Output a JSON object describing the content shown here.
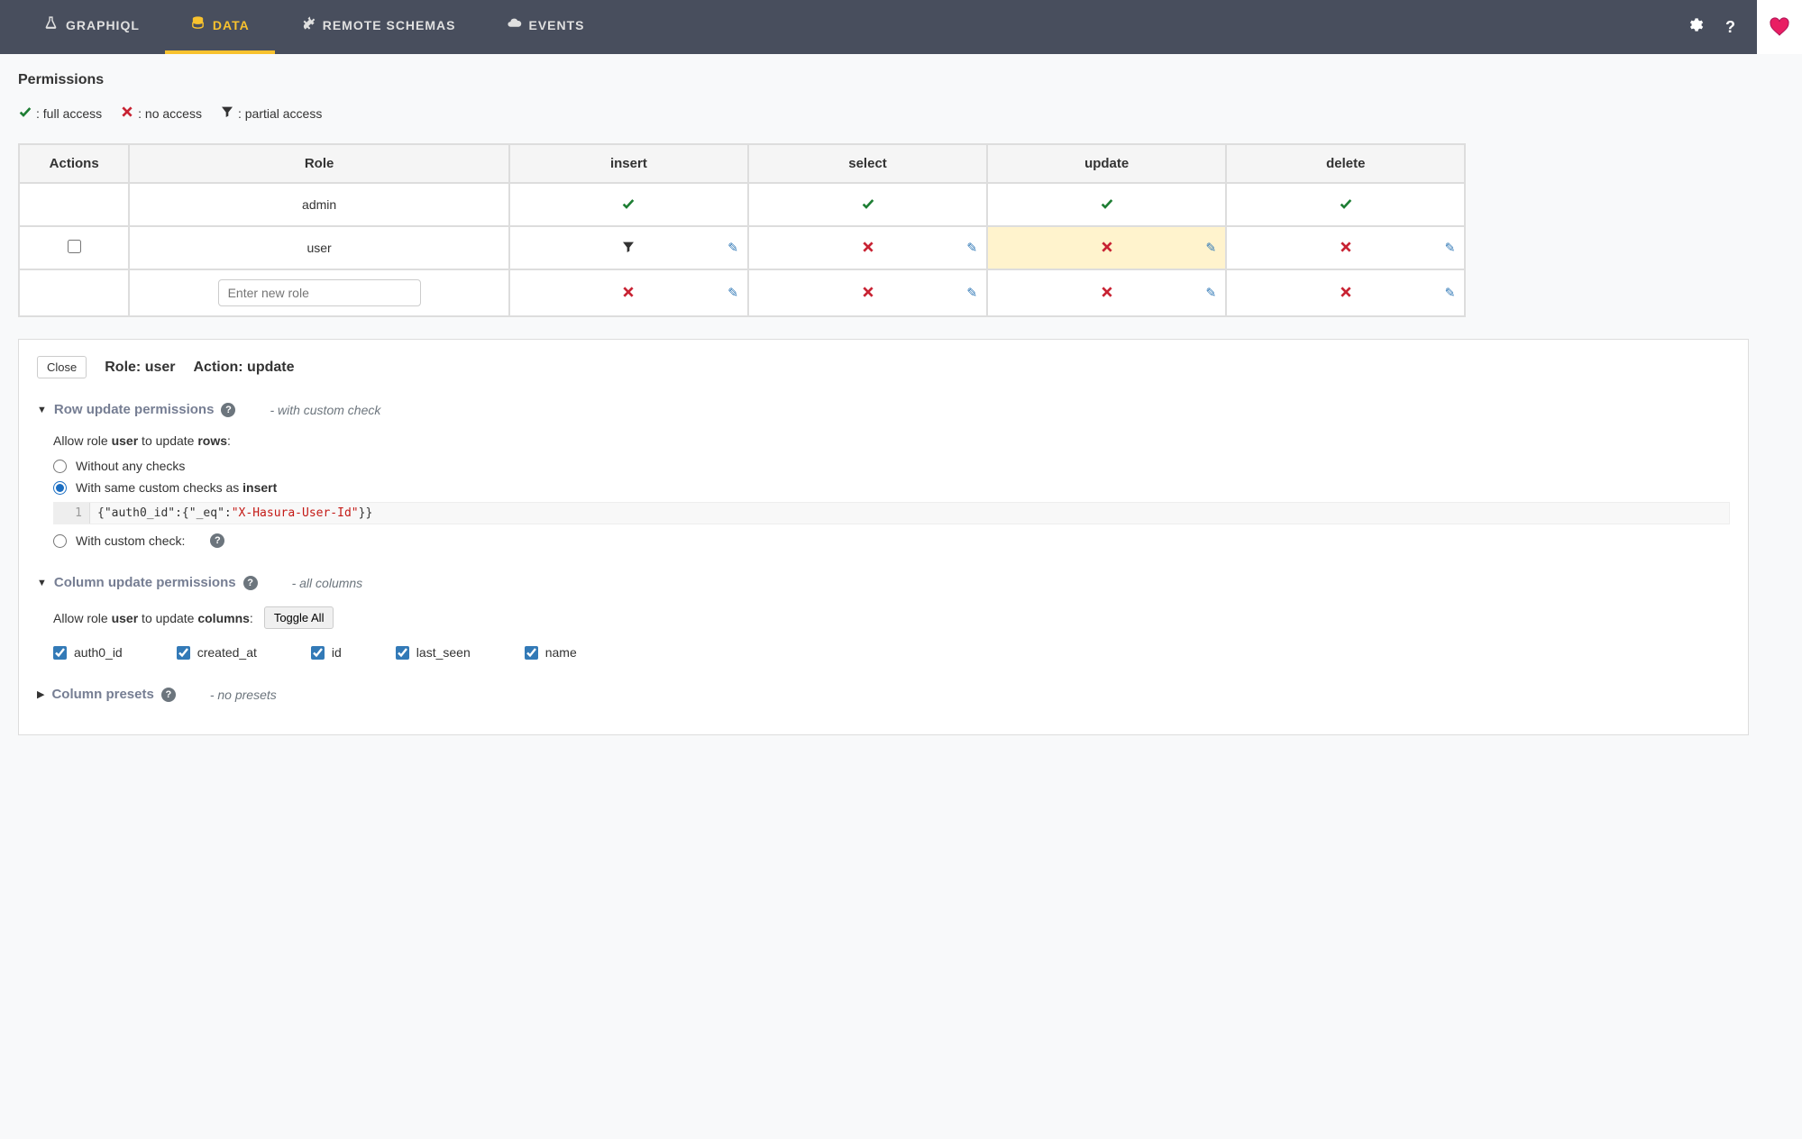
{
  "nav": {
    "items": [
      {
        "label": "GRAPHIQL",
        "icon": "flask"
      },
      {
        "label": "DATA",
        "icon": "database",
        "active": true
      },
      {
        "label": "REMOTE SCHEMAS",
        "icon": "plug"
      },
      {
        "label": "EVENTS",
        "icon": "cloud"
      }
    ],
    "right_icons": [
      "gear-icon",
      "help-icon",
      "heart-icon"
    ]
  },
  "section_title": "Permissions",
  "legend": {
    "full": ": full access",
    "none": ": no access",
    "partial": ": partial access"
  },
  "table": {
    "headers": {
      "actions": "Actions",
      "role": "Role",
      "insert": "insert",
      "select": "select",
      "update": "update",
      "delete": "delete"
    },
    "rows": [
      {
        "role": "admin",
        "cells": {
          "insert": "full",
          "select": "full",
          "update": "full",
          "delete": "full"
        },
        "editable": false
      },
      {
        "role": "user",
        "cells": {
          "insert": "partial",
          "select": "none",
          "update": "none",
          "delete": "none"
        },
        "editable": true,
        "highlighted": "update"
      }
    ],
    "new_role_placeholder": "Enter new role",
    "new_row_cells": {
      "insert": "none",
      "select": "none",
      "update": "none",
      "delete": "none"
    }
  },
  "editor": {
    "close_label": "Close",
    "role_label": "Role: ",
    "role_value": "user",
    "action_label": "Action: ",
    "action_value": "update",
    "row_perms": {
      "title": "Row update permissions",
      "annotation": "- with custom check",
      "allow_prefix": "Allow role ",
      "allow_role": "user",
      "allow_mid": " to update ",
      "allow_suffix": "rows",
      "option_no_check": "Without any checks",
      "option_same_prefix": "With same custom checks as ",
      "option_same_bold": "insert",
      "code_line_num": "1",
      "code_json": "{\"auth0_id\":{\"_eq\":\"X-Hasura-User-Id\"}}",
      "option_custom": "With custom check:"
    },
    "col_perms": {
      "title": "Column update permissions",
      "annotation": "- all columns",
      "allow_prefix": "Allow role ",
      "allow_role": "user",
      "allow_mid": " to update ",
      "allow_suffix": "columns",
      "toggle_label": "Toggle All",
      "columns": [
        {
          "name": "auth0_id",
          "checked": true
        },
        {
          "name": "created_at",
          "checked": true
        },
        {
          "name": "id",
          "checked": true
        },
        {
          "name": "last_seen",
          "checked": true
        },
        {
          "name": "name",
          "checked": true
        }
      ]
    },
    "presets": {
      "title": "Column presets",
      "annotation": "- no presets"
    }
  }
}
